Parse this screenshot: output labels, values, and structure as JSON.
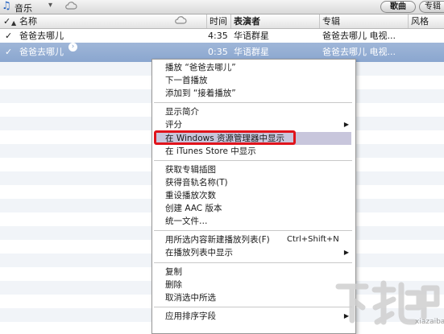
{
  "toolbar": {
    "title": "音乐",
    "song_button": "歌曲",
    "album_button": "专辑"
  },
  "columns": {
    "check": "✓",
    "name": "名称",
    "time": "时间",
    "artist": "表演者",
    "album": "专辑",
    "genre": "风格"
  },
  "rows": [
    {
      "check": "✓",
      "name": "爸爸去哪儿",
      "time": "4:35",
      "artist": "华语群星",
      "album": "爸爸去哪儿 电视..."
    },
    {
      "check": "✓",
      "name": "爸爸去哪儿",
      "time": "0:35",
      "artist": "华语群星",
      "album": "爸爸去哪儿 电视..."
    }
  ],
  "menu": {
    "items": [
      "播放 “爸爸去哪儿”",
      "下一首播放",
      "添加到 “接着播放”",
      "显示简介",
      "评分",
      "在 Windows 资源管理器中显示",
      "在 iTunes Store 中显示",
      "获取专辑插图",
      "获得音轨名称(T)",
      "重设播放次数",
      "创建 AAC 版本",
      "统一文件…",
      "用所选内容新建播放列表(F)",
      "在播放列表中显示",
      "复制",
      "删除",
      "取消选中所选",
      "应用排序字段"
    ],
    "shortcut_new_playlist": "Ctrl+Shift+N"
  },
  "watermark": "xiazaiba.com",
  "colors": {
    "selection": "#8aa6cf",
    "highlight_red": "#e0141c",
    "menu_hover": "#c8c6dc"
  }
}
